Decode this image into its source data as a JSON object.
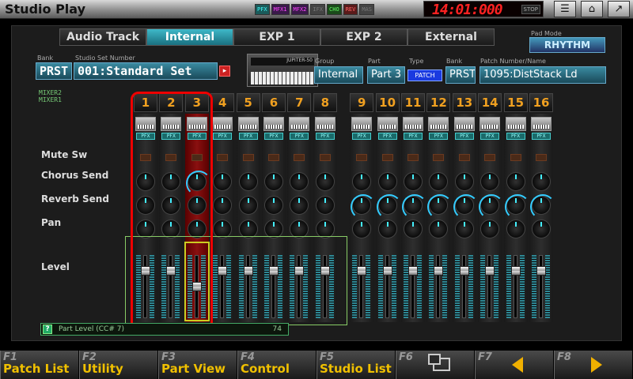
{
  "app_title": "Studio Play",
  "fx_indicators": [
    "PFX",
    "MFX1",
    "MFX2",
    "IFX",
    "CHO",
    "REV",
    "MAS"
  ],
  "clock": {
    "time": "14:01:000",
    "status": "STOP"
  },
  "tabs": [
    {
      "label": "Audio Track",
      "active": false
    },
    {
      "label": "Internal",
      "active": true
    },
    {
      "label": "EXP 1",
      "active": false
    },
    {
      "label": "EXP 2",
      "active": false
    },
    {
      "label": "External",
      "active": false
    }
  ],
  "pad_mode": {
    "label": "Pad Mode",
    "value": "RHYTHM"
  },
  "bank": {
    "label": "Bank",
    "value": "PRST"
  },
  "studio_set": {
    "label": "Studio Set Number",
    "value": "001:Standard Set"
  },
  "synth_name": "JUPITER-50",
  "part_info": {
    "group": {
      "label": "Group",
      "value": "Internal"
    },
    "part": {
      "label": "Part",
      "value": "Part 3"
    },
    "type": {
      "label": "Type",
      "value": "PATCH"
    },
    "bank": {
      "label": "Bank",
      "value": "PRST"
    },
    "patch": {
      "label": "Patch Number/Name",
      "value": "1095:DistStack Ld"
    }
  },
  "mixer_tags": [
    "MIXER2",
    "MIXER1"
  ],
  "row_labels": {
    "mute": "Mute Sw",
    "chorus": "Chorus Send",
    "reverb": "Reverb Send",
    "pan": "Pan",
    "level": "Level"
  },
  "channels": [
    {
      "num": "1",
      "pfx": "PFX",
      "fader": 0.75
    },
    {
      "num": "2",
      "pfx": "PFX",
      "fader": 0.75
    },
    {
      "num": "3",
      "pfx": "PFX",
      "fader": 0.5
    },
    {
      "num": "4",
      "pfx": "PFX",
      "fader": 0.75
    },
    {
      "num": "5",
      "pfx": "PFX",
      "fader": 0.75
    },
    {
      "num": "6",
      "pfx": "PFX",
      "fader": 0.75
    },
    {
      "num": "7",
      "pfx": "PFX",
      "fader": 0.75
    },
    {
      "num": "8",
      "pfx": "PFX",
      "fader": 0.75
    },
    {
      "num": "9",
      "pfx": "PFX",
      "fader": 0.75
    },
    {
      "num": "10",
      "pfx": "PFX",
      "fader": 0.75
    },
    {
      "num": "11",
      "pfx": "PFX",
      "fader": 0.75
    },
    {
      "num": "12",
      "pfx": "PFX",
      "fader": 0.75
    },
    {
      "num": "13",
      "pfx": "PFX",
      "fader": 0.75
    },
    {
      "num": "14",
      "pfx": "PFX",
      "fader": 0.75
    },
    {
      "num": "15",
      "pfx": "PFX",
      "fader": 0.75
    },
    {
      "num": "16",
      "pfx": "PFX",
      "fader": 0.75
    }
  ],
  "status_bar": {
    "help": "?",
    "label": "Part Level (CC# 7)",
    "value": "74"
  },
  "function_keys": [
    {
      "num": "F1",
      "label": "Patch List"
    },
    {
      "num": "F2",
      "label": "Utility"
    },
    {
      "num": "F3",
      "label": "Part View"
    },
    {
      "num": "F4",
      "label": "Control"
    },
    {
      "num": "F5",
      "label": "Studio List"
    },
    {
      "num": "F6",
      "label": ""
    },
    {
      "num": "F7",
      "label": ""
    },
    {
      "num": "F8",
      "label": ""
    }
  ]
}
